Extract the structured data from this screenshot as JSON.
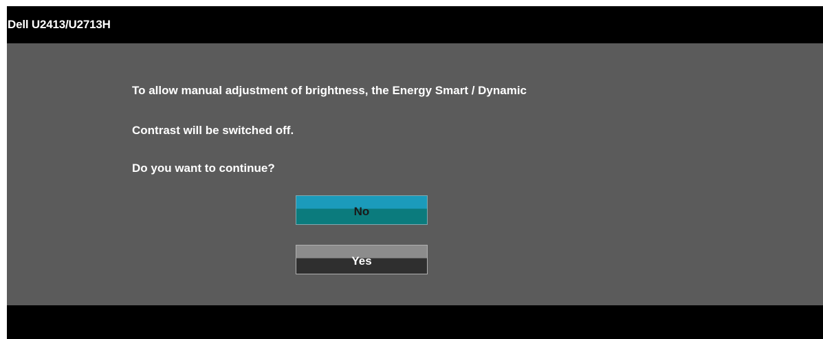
{
  "window": {
    "title": "Dell U2413/U2713H"
  },
  "dialog": {
    "message_lines": [
      "To allow manual adjustment of brightness, the Energy Smart / Dynamic",
      "Contrast will be switched off.",
      "Do you want to continue?"
    ],
    "buttons": {
      "no_label": "No",
      "yes_label": "Yes"
    },
    "selected_button": "No"
  },
  "colors": {
    "background": "#5b5b5b",
    "title_bar": "#000000",
    "selected_button_top": "#1b9bbb",
    "selected_button_bottom": "#0b7b7d",
    "unselected_button_top": "#8c8c8c",
    "unselected_button_bottom": "#2f2f2f"
  }
}
